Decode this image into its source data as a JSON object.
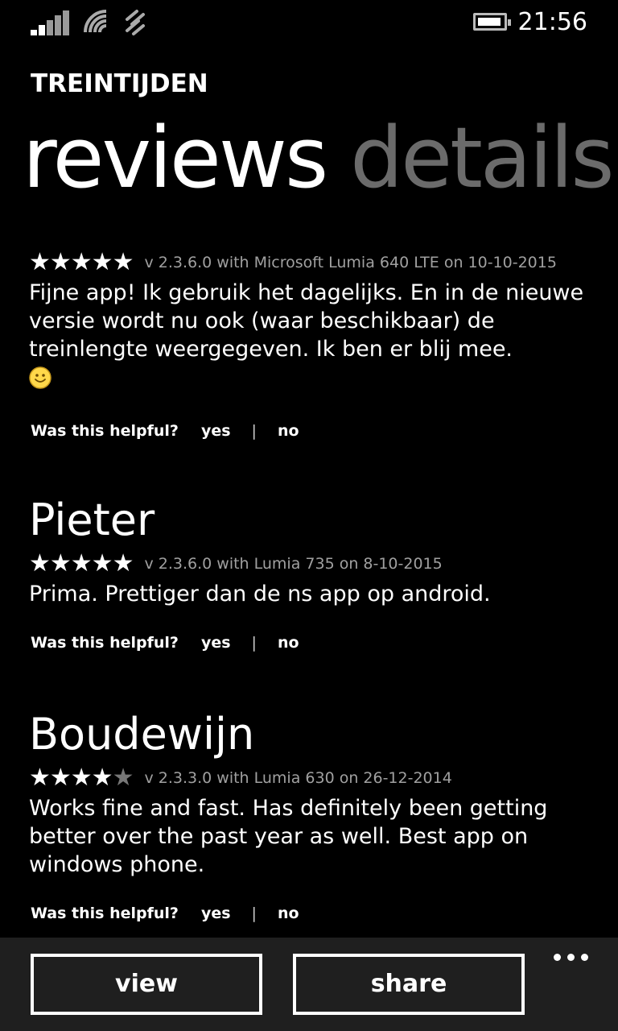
{
  "status_bar": {
    "time": "21:56",
    "icons": [
      "signal-icon",
      "wifi-icon",
      "data-connection-icon",
      "battery-icon"
    ]
  },
  "app_title": "TREINTIJDEN",
  "pivot": {
    "active": "reviews",
    "inactive": "details"
  },
  "reviews": [
    {
      "name": "",
      "stars": "★★★★★",
      "stars_dim": "",
      "rating": 5,
      "meta": "v 2.3.6.0 with Microsoft Lumia 640 LTE on 10-10-2015",
      "text": "Fijne app! Ik gebruik het dagelijks. En in de nieuwe versie wordt nu ook (waar beschikbaar) de treinlengte weergegeven. Ik ben er blij mee.",
      "emoji": "smiley-icon"
    },
    {
      "name": "Pieter",
      "stars": "★★★★★",
      "stars_dim": "",
      "rating": 5,
      "meta": "v 2.3.6.0 with Lumia 735 on 8-10-2015",
      "text": "Prima. Prettiger dan de ns app op android."
    },
    {
      "name": "Boudewijn",
      "stars": "★★★★",
      "stars_dim": "★",
      "rating": 4,
      "meta": "v 2.3.3.0 with Lumia 630 on 26-12-2014",
      "text": "Works fine and fast. Has definitely been getting better over the past year as well. Best app on windows phone."
    }
  ],
  "helpful": {
    "question": "Was this helpful?",
    "yes": "yes",
    "separator": "|",
    "no": "no"
  },
  "app_bar": {
    "view": "view",
    "share": "share",
    "more_icon": "more-ellipsis-icon"
  },
  "colors": {
    "background": "#000000",
    "app_bar": "#1f1f1f",
    "inactive_pivot": "#6b6b6b",
    "meta_text": "#a0a0a0"
  }
}
